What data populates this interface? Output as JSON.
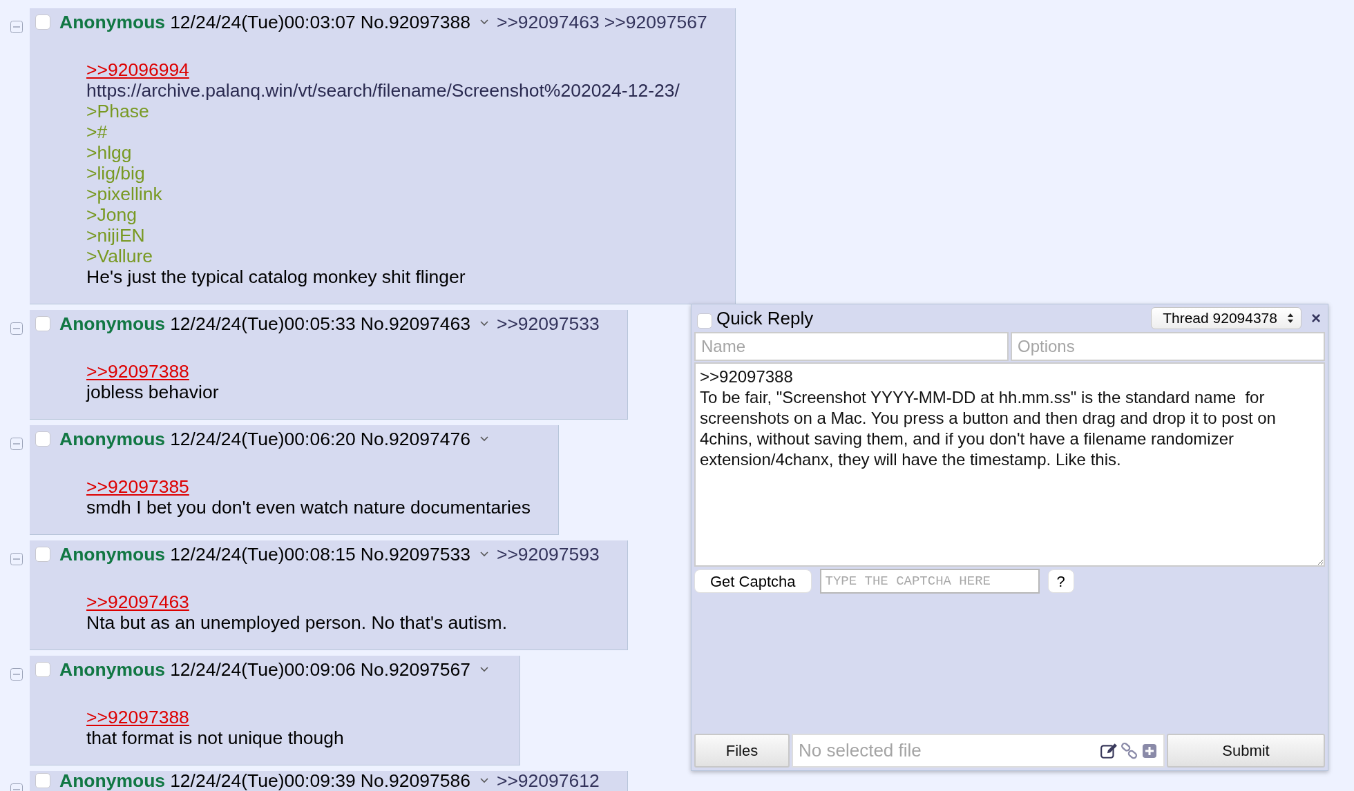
{
  "posts": [
    {
      "name": "Anonymous",
      "datetime": "12/24/24(Tue)00:03:07",
      "number": "No.92097388",
      "checked": false,
      "backlinks": [
        ">>92097463",
        ">>92097567"
      ],
      "lines": [
        {
          "kind": "quotelink",
          "text": ">>92096994"
        },
        {
          "kind": "link",
          "text": "https://archive.palanq.win/vt/search/filename/Screenshot%202024-12-23/"
        },
        {
          "kind": "greentext",
          "text": ">Phase"
        },
        {
          "kind": "greentext",
          "text": ">#"
        },
        {
          "kind": "greentext",
          "text": ">hlgg"
        },
        {
          "kind": "greentext",
          "text": ">lig/big"
        },
        {
          "kind": "greentext",
          "text": ">pixellink"
        },
        {
          "kind": "greentext",
          "text": ">Jong"
        },
        {
          "kind": "greentext",
          "text": ">nijiEN"
        },
        {
          "kind": "greentext",
          "text": ">Vallure"
        },
        {
          "kind": "text",
          "text": "He's just the typical catalog monkey shit flinger"
        }
      ]
    },
    {
      "name": "Anonymous",
      "datetime": "12/24/24(Tue)00:05:33",
      "number": "No.92097463",
      "checked": false,
      "backlinks": [
        ">>92097533"
      ],
      "lines": [
        {
          "kind": "quotelink",
          "text": ">>92097388"
        },
        {
          "kind": "text",
          "text": "jobless behavior"
        }
      ]
    },
    {
      "name": "Anonymous",
      "datetime": "12/24/24(Tue)00:06:20",
      "number": "No.92097476",
      "checked": false,
      "lines": [
        {
          "kind": "quotelink",
          "text": ">>92097385"
        },
        {
          "kind": "text",
          "text": "smdh I bet you don't even watch nature documentaries"
        }
      ]
    },
    {
      "name": "Anonymous",
      "datetime": "12/24/24(Tue)00:08:15",
      "number": "No.92097533",
      "checked": false,
      "backlinks": [
        ">>92097593"
      ],
      "lines": [
        {
          "kind": "quotelink",
          "text": ">>92097463"
        },
        {
          "kind": "text",
          "text": "Nta but as an unemployed person. No that's autism."
        }
      ]
    },
    {
      "name": "Anonymous",
      "datetime": "12/24/24(Tue)00:09:06",
      "number": "No.92097567",
      "checked": false,
      "lines": [
        {
          "kind": "quotelink",
          "text": ">>92097388"
        },
        {
          "kind": "text",
          "text": "that format is not unique though"
        }
      ]
    },
    {
      "name": "Anonymous",
      "datetime": "12/24/24(Tue)00:09:39",
      "number": "No.92097586",
      "checked": false,
      "backlinks": [
        ">>92097612"
      ]
    }
  ],
  "quick_reply": {
    "title": "Quick Reply",
    "checked": false,
    "thread": "Thread 92094378",
    "close": "×",
    "name_field": {
      "placeholder": "Name"
    },
    "options_field": {
      "placeholder": "Options"
    },
    "comment": ">>92097388\nTo be fair, \"Screenshot YYYY-MM-DD at hh.mm.ss\" is the standard name  for screenshots on a Mac. You press a button and then drag and drop it to post on 4chins, without saving them, and if you don't have a filename randomizer extension/4chanx, they will have the timestamp. Like this.",
    "captcha_button": "Get Captcha",
    "captcha_field": {
      "placeholder": "TYPE THE CAPTCHA HERE"
    },
    "help_button": "?",
    "files_button": "Files",
    "file_field": {
      "placeholder": "No selected file"
    },
    "submit_button": "Submit"
  }
}
